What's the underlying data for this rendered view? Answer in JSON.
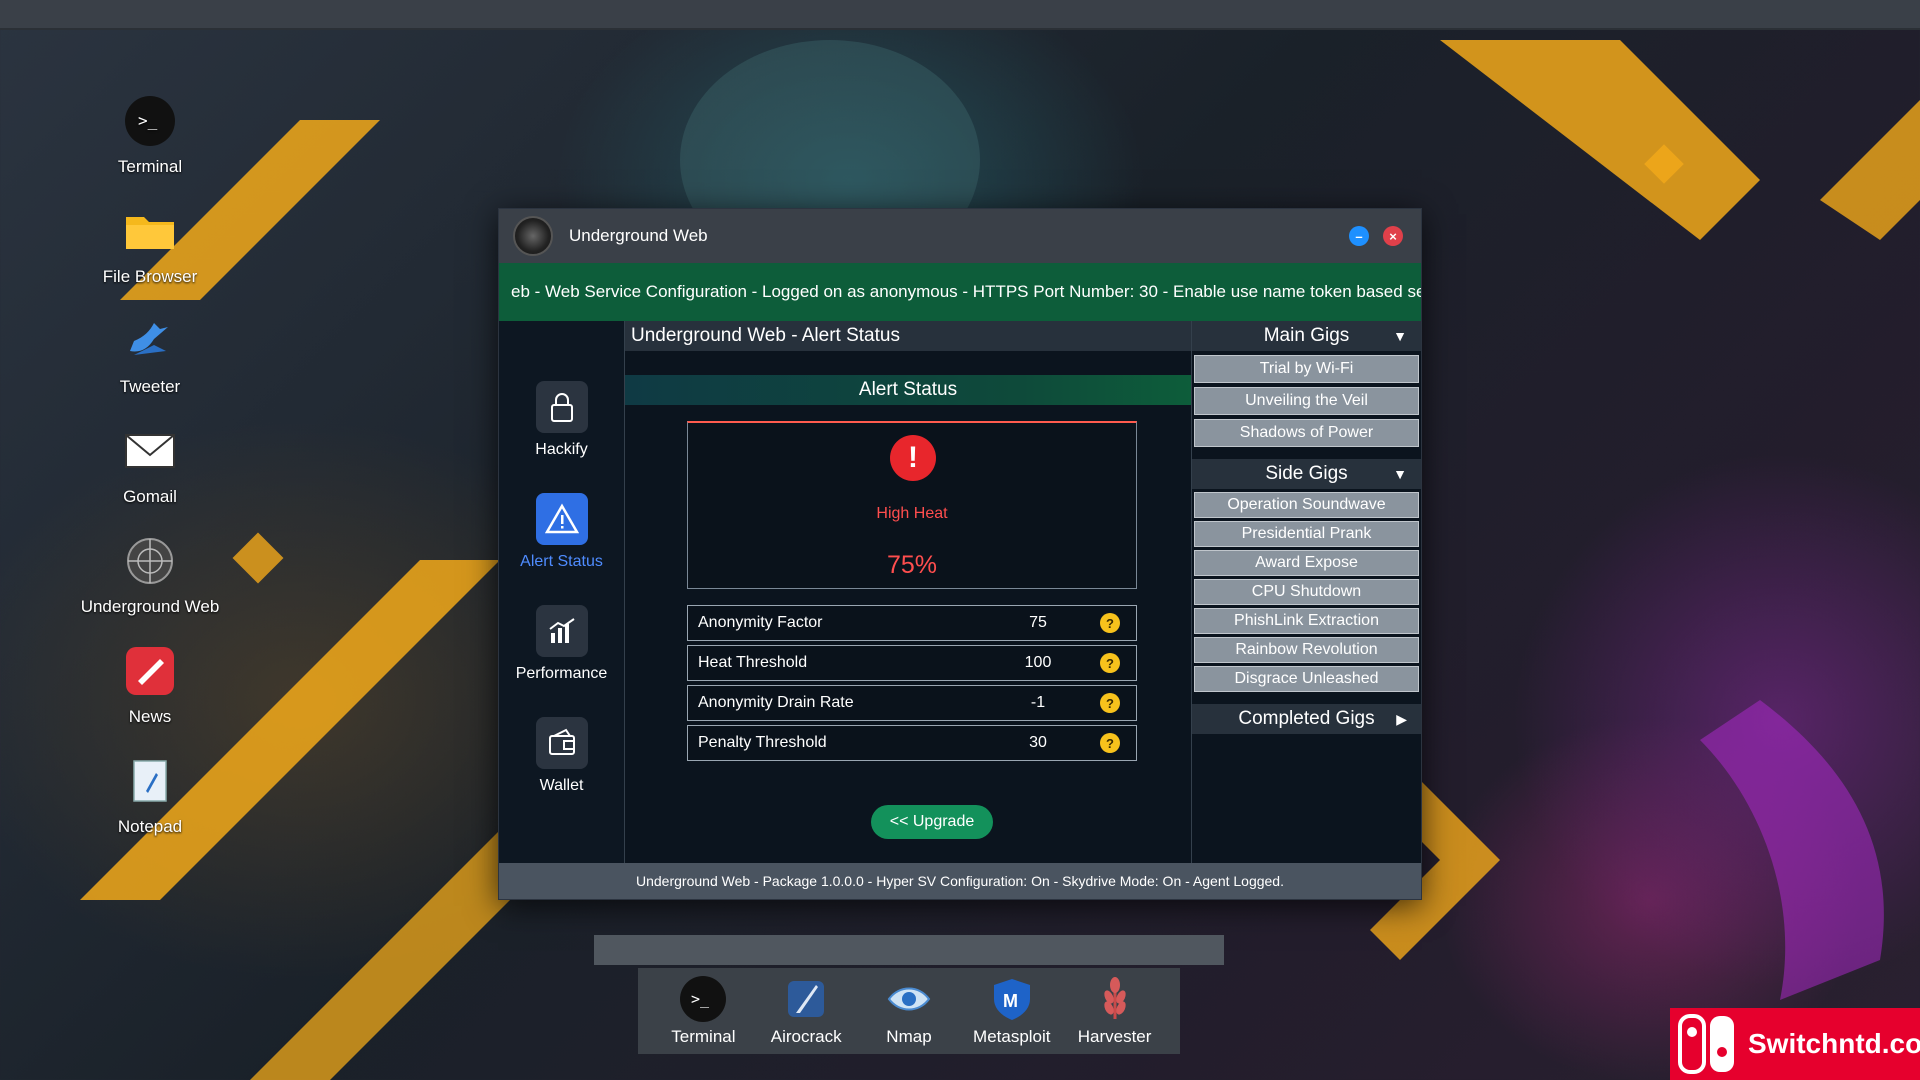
{
  "desktop": {
    "icons": [
      {
        "label": "Terminal",
        "icon": "terminal-icon"
      },
      {
        "label": "File Browser",
        "icon": "folder-icon"
      },
      {
        "label": "Tweeter",
        "icon": "bird-icon"
      },
      {
        "label": "Gomail",
        "icon": "mail-icon"
      },
      {
        "label": "Underground Web",
        "icon": "globe-icon"
      },
      {
        "label": "News",
        "icon": "news-icon"
      },
      {
        "label": "Notepad",
        "icon": "notepad-icon"
      }
    ]
  },
  "window": {
    "title": "Underground Web",
    "marquee": "eb - Web Service Configuration - Logged on as anonymous - HTTPS Port Number: 30 - Enable use name token based se",
    "sidebar": [
      {
        "label": "Hackify",
        "icon": "lock-icon"
      },
      {
        "label": "Alert Status",
        "icon": "warning-icon",
        "active": true
      },
      {
        "label": "Performance",
        "icon": "chart-icon"
      },
      {
        "label": "Wallet",
        "icon": "wallet-icon"
      }
    ],
    "content_title": "Underground Web - Alert Status",
    "section_title": "Alert Status",
    "alert": {
      "symbol": "!",
      "label": "High Heat",
      "value": "75%"
    },
    "stats": [
      {
        "label": "Anonymity Factor",
        "value": "75"
      },
      {
        "label": "Heat Threshold",
        "value": "100"
      },
      {
        "label": "Anonymity Drain Rate",
        "value": "-1"
      },
      {
        "label": "Penalty Threshold",
        "value": "30"
      }
    ],
    "upgrade_label": "<< Upgrade",
    "main_gigs": {
      "title": "Main Gigs",
      "items": [
        "Trial by Wi-Fi",
        "Unveiling the Veil",
        "Shadows of Power"
      ]
    },
    "side_gigs": {
      "title": "Side Gigs",
      "items": [
        "Operation Soundwave",
        "Presidential Prank",
        "Award Expose",
        "CPU Shutdown",
        "PhishLink Extraction",
        "Rainbow Revolution",
        "Disgrace Unleashed"
      ]
    },
    "completed_gigs": {
      "title": "Completed Gigs"
    },
    "status": "Underground Web - Package 1.0.0.0 - Hyper SV Configuration: On - Skydrive Mode: On - Agent Logged."
  },
  "dock": [
    {
      "label": "Terminal",
      "icon": "terminal-icon"
    },
    {
      "label": "Airocrack",
      "icon": "feather-icon"
    },
    {
      "label": "Nmap",
      "icon": "eye-icon"
    },
    {
      "label": "Metasploit",
      "icon": "shield-icon"
    },
    {
      "label": "Harvester",
      "icon": "wheat-icon"
    }
  ],
  "watermark": {
    "text": "Switchntd.com"
  },
  "colors": {
    "accent": "#2f6fe4",
    "alert": "#e8262c",
    "success": "#13915b",
    "marquee": "#0d5d3a"
  }
}
